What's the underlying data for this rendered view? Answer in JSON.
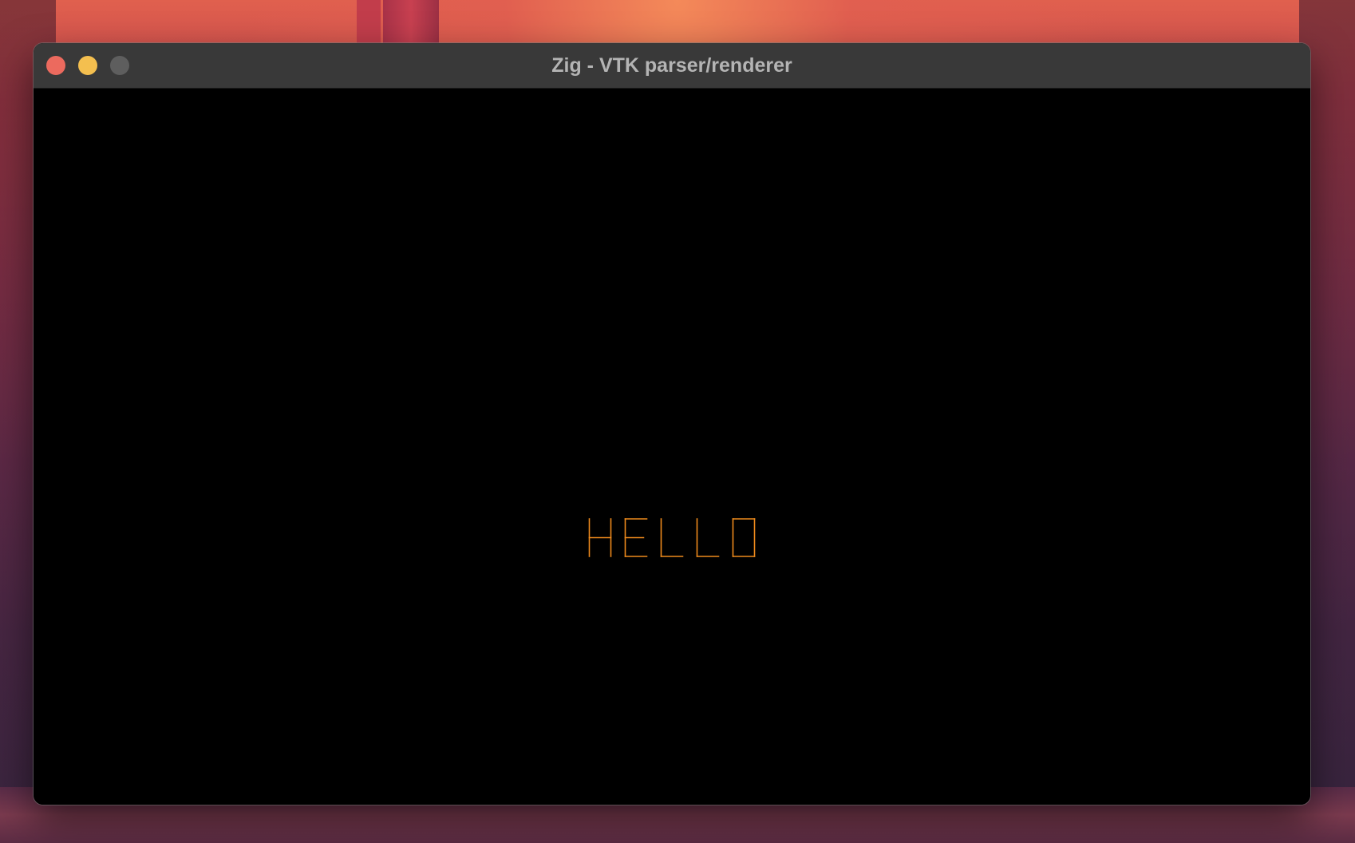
{
  "window": {
    "title": "Zig - VTK parser/renderer",
    "buttons": {
      "close_color": "#ec6a5e",
      "minimize_color": "#f4bf4f",
      "zoom_color": "#5e5e5e"
    }
  },
  "canvas": {
    "text": "HELLO",
    "text_color": "#ee8a1c",
    "background": "#000000"
  }
}
